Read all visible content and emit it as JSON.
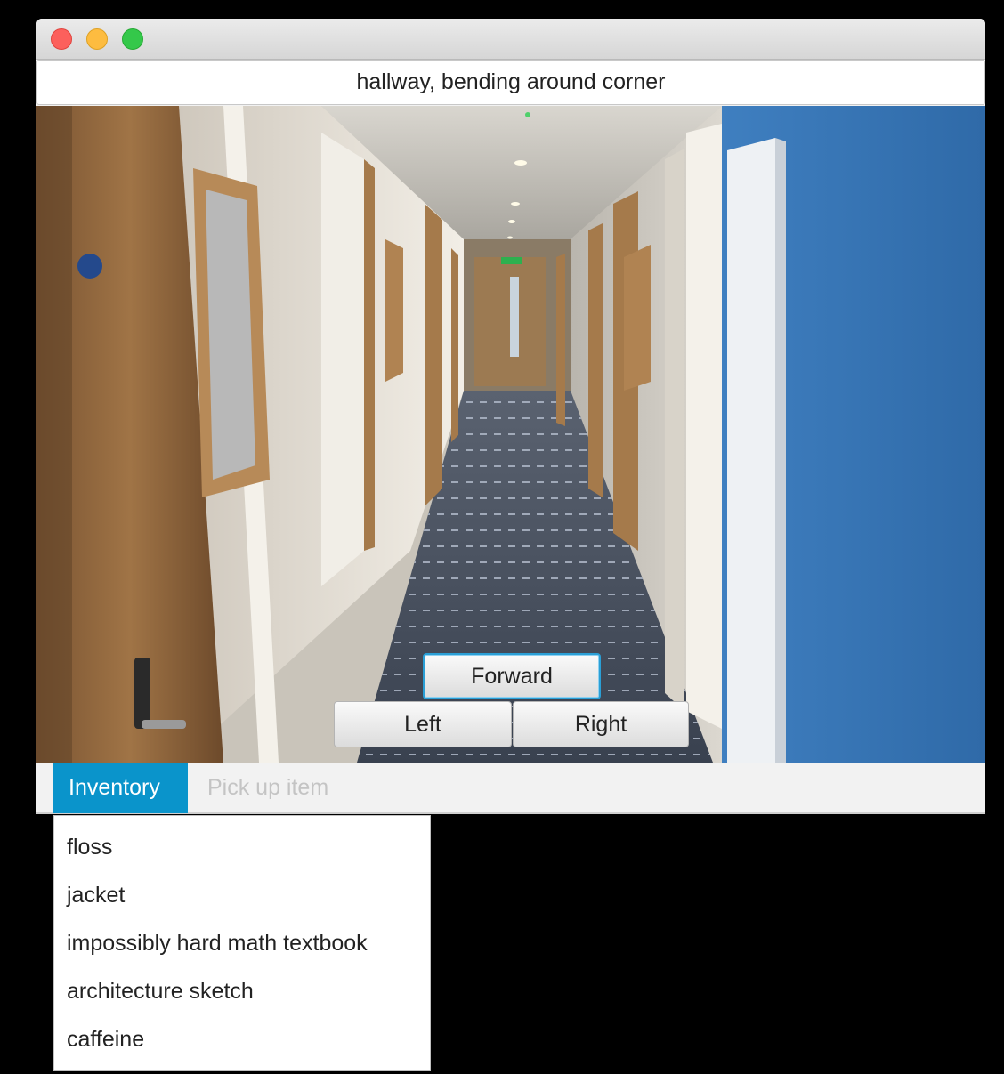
{
  "window": {
    "title": "",
    "location": "hallway, bending around corner"
  },
  "scene": {
    "description_icon": "hallway-photo"
  },
  "navigation": {
    "forward_label": "Forward",
    "left_label": "Left",
    "right_label": "Right"
  },
  "tabs": [
    {
      "label": "Inventory",
      "active": true
    },
    {
      "label": "Pick up item",
      "active": false
    }
  ],
  "inventory": {
    "items": [
      {
        "label": "floss"
      },
      {
        "label": "jacket"
      },
      {
        "label": "impossibly hard math textbook"
      },
      {
        "label": "architecture sketch"
      },
      {
        "label": "caffeine"
      }
    ]
  },
  "colors": {
    "accent": "#0a94cb",
    "focus_ring": "#2a9fd6",
    "close": "#fc605c",
    "minimize": "#fdbc40",
    "maximize": "#34c84a"
  }
}
